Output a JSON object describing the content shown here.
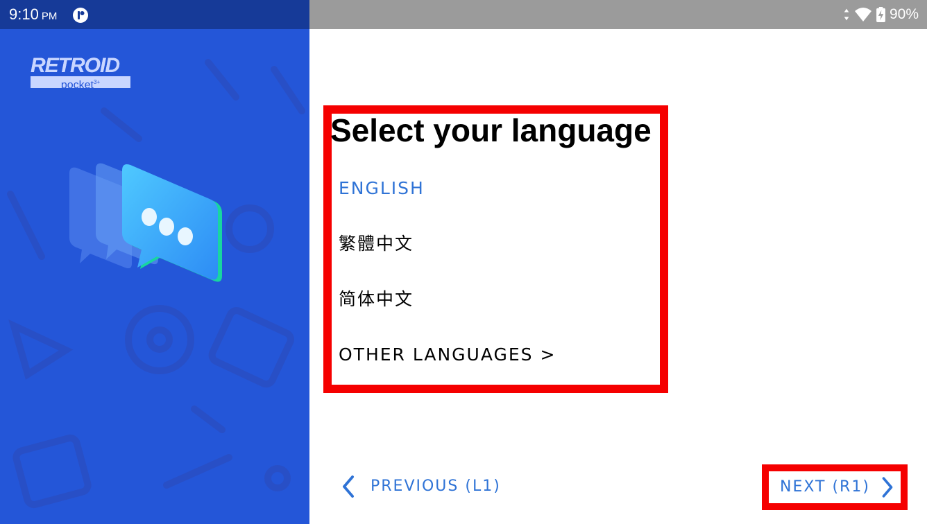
{
  "status_bar": {
    "time": "9:10",
    "ampm": "PM",
    "battery": "90%",
    "icons": [
      "notification-app-icon",
      "data-arrows-icon",
      "wifi-icon",
      "battery-charging-icon"
    ]
  },
  "brand": {
    "logo_main": "RETROID",
    "logo_sub": "pocket",
    "logo_superscript": "3+"
  },
  "page": {
    "title": "Select your language",
    "languages": [
      {
        "label": "ENGLISH",
        "selected": true
      },
      {
        "label": "繁體中文",
        "selected": false
      },
      {
        "label": "简体中文",
        "selected": false
      },
      {
        "label": "OTHER LANGUAGES >",
        "selected": false
      }
    ]
  },
  "navigation": {
    "previous_label": "PREVIOUS (L1)",
    "next_label": "NEXT (R1)"
  },
  "colors": {
    "panel_blue": "#2456d8",
    "status_left": "#163a98",
    "status_right": "#9b9b9b",
    "accent": "#2f73d6",
    "highlight_red": "#f50000"
  }
}
